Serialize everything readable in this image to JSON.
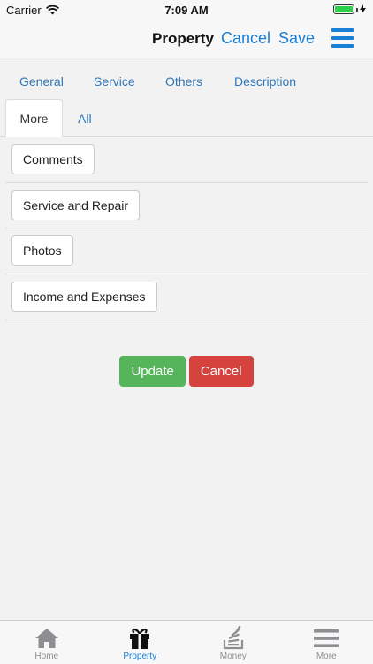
{
  "status_bar": {
    "carrier": "Carrier",
    "time": "7:09 AM"
  },
  "nav": {
    "title": "Property",
    "cancel_label": "Cancel",
    "save_label": "Save",
    "menu_icon": "hamburger-menu-icon"
  },
  "tabs_primary": [
    {
      "label": "General"
    },
    {
      "label": "Service"
    },
    {
      "label": "Others"
    },
    {
      "label": "Description"
    }
  ],
  "tabs_secondary": [
    {
      "label": "More",
      "active": true
    },
    {
      "label": "All",
      "active": false
    }
  ],
  "more_items": [
    {
      "label": "Comments"
    },
    {
      "label": "Service and Repair"
    },
    {
      "label": "Photos"
    },
    {
      "label": "Income and Expenses"
    }
  ],
  "actions": {
    "update_label": "Update",
    "cancel_label": "Cancel"
  },
  "tabbar": [
    {
      "label": "Home",
      "icon": "home-icon",
      "active": false
    },
    {
      "label": "Property",
      "icon": "gift-icon",
      "active": true
    },
    {
      "label": "Money",
      "icon": "stack-icon",
      "active": false
    },
    {
      "label": "More",
      "icon": "menu-icon",
      "active": false
    }
  ],
  "colors": {
    "accent": "#1a7fd6",
    "link": "#2f76b8",
    "update": "#56b45b",
    "cancel": "#d6423e",
    "battery": "#2bd14b"
  }
}
